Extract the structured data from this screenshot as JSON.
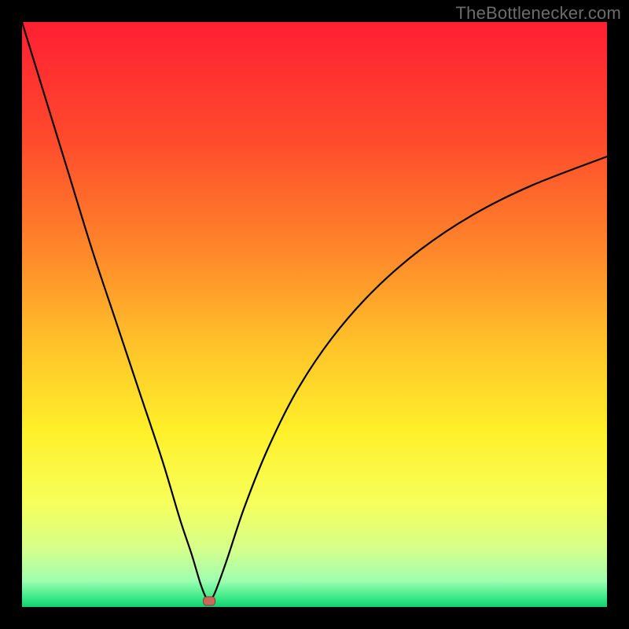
{
  "watermark": "TheBottlenecker.com",
  "colors": {
    "frame": "#000000",
    "curve": "#000000",
    "marker_fill": "#c86a5a",
    "marker_stroke": "#8a3f36",
    "gradient_stops": [
      {
        "offset": 0.0,
        "color": "#ff1f33"
      },
      {
        "offset": 0.2,
        "color": "#ff4a2c"
      },
      {
        "offset": 0.4,
        "color": "#ff8a2a"
      },
      {
        "offset": 0.55,
        "color": "#ffc22a"
      },
      {
        "offset": 0.7,
        "color": "#fff02a"
      },
      {
        "offset": 0.82,
        "color": "#f7ff5a"
      },
      {
        "offset": 0.9,
        "color": "#d6ff8a"
      },
      {
        "offset": 0.955,
        "color": "#9fffb0"
      },
      {
        "offset": 0.985,
        "color": "#38e887"
      },
      {
        "offset": 1.0,
        "color": "#10cf70"
      }
    ]
  },
  "chart_data": {
    "type": "line",
    "title": "",
    "xlabel": "",
    "ylabel": "",
    "xlim": [
      0,
      100
    ],
    "ylim": [
      0,
      100
    ],
    "grid": false,
    "legend": false,
    "marker": {
      "x": 32,
      "y": 1.0
    },
    "series": [
      {
        "name": "bottleneck-curve",
        "x": [
          0,
          4,
          8,
          12,
          16,
          20,
          24,
          27,
          29,
          30.5,
          31.5,
          32,
          33,
          35,
          38,
          42,
          47,
          53,
          60,
          68,
          77,
          87,
          100
        ],
        "y": [
          100,
          87,
          74,
          61,
          49,
          37,
          25,
          15,
          9,
          4,
          1.5,
          1,
          2.5,
          8,
          17,
          27,
          37,
          46,
          54,
          61,
          67,
          72,
          77
        ]
      }
    ]
  }
}
